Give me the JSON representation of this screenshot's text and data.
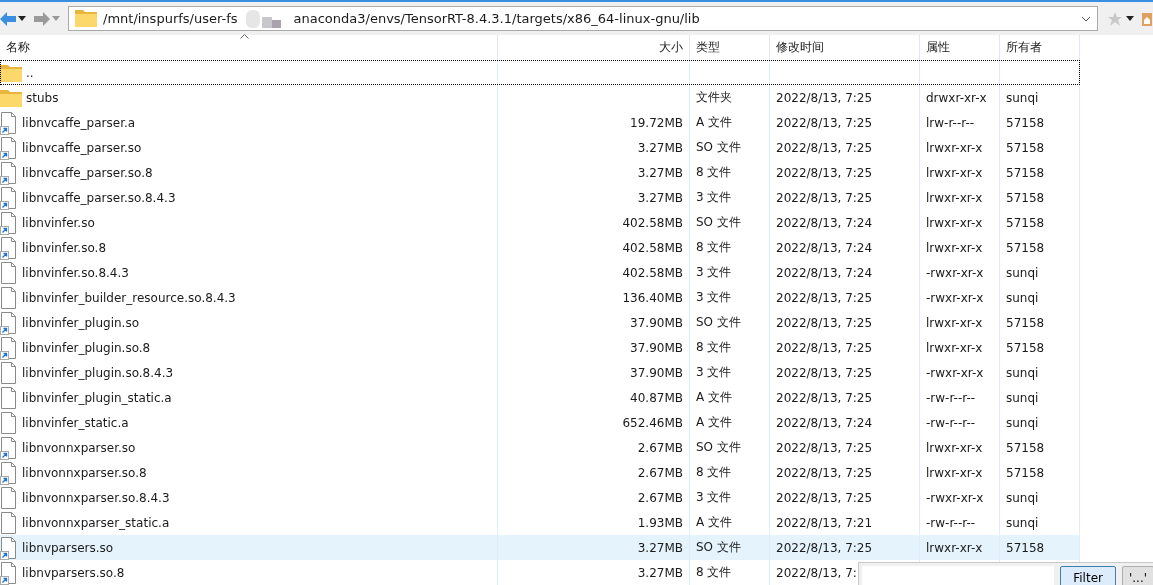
{
  "toolbar": {
    "path_start": "/mnt/inspurfs/user-fs",
    "path_end": "anaconda3/envs/TensorRT-8.4.3.1/targets/x86_64-linux-gnu/lib"
  },
  "columns": [
    "名称",
    "大小",
    "类型",
    "修改时间",
    "属性",
    "所有者"
  ],
  "rows": [
    {
      "kind": "folder",
      "name": "..",
      "selected": false,
      "focused": true
    },
    {
      "kind": "folder",
      "name": "stubs",
      "type": "文件夹",
      "modified": "2022/8/13, 7:25",
      "attributes": "drwxr-xr-x",
      "owner": "sunqi",
      "selected": false,
      "focused": false
    },
    {
      "kind": "link",
      "name": "libnvcaffe_parser.a",
      "size": "19.72MB",
      "type": "A 文件",
      "modified": "2022/8/13, 7:25",
      "attributes": "lrw-r--r--",
      "owner": "57158",
      "selected": false,
      "focused": false
    },
    {
      "kind": "link",
      "name": "libnvcaffe_parser.so",
      "size": "3.27MB",
      "type": "SO 文件",
      "modified": "2022/8/13, 7:25",
      "attributes": "lrwxr-xr-x",
      "owner": "57158",
      "selected": false,
      "focused": false
    },
    {
      "kind": "link",
      "name": "libnvcaffe_parser.so.8",
      "size": "3.27MB",
      "type": "8 文件",
      "modified": "2022/8/13, 7:25",
      "attributes": "lrwxr-xr-x",
      "owner": "57158",
      "selected": false,
      "focused": false
    },
    {
      "kind": "link",
      "name": "libnvcaffe_parser.so.8.4.3",
      "size": "3.27MB",
      "type": "3 文件",
      "modified": "2022/8/13, 7:25",
      "attributes": "lrwxr-xr-x",
      "owner": "57158",
      "selected": false,
      "focused": false
    },
    {
      "kind": "link",
      "name": "libnvinfer.so",
      "size": "402.58MB",
      "type": "SO 文件",
      "modified": "2022/8/13, 7:24",
      "attributes": "lrwxr-xr-x",
      "owner": "57158",
      "selected": false,
      "focused": false
    },
    {
      "kind": "link",
      "name": "libnvinfer.so.8",
      "size": "402.58MB",
      "type": "8 文件",
      "modified": "2022/8/13, 7:24",
      "attributes": "lrwxr-xr-x",
      "owner": "57158",
      "selected": false,
      "focused": false
    },
    {
      "kind": "file",
      "name": "libnvinfer.so.8.4.3",
      "size": "402.58MB",
      "type": "3 文件",
      "modified": "2022/8/13, 7:24",
      "attributes": "-rwxr-xr-x",
      "owner": "sunqi",
      "selected": false,
      "focused": false
    },
    {
      "kind": "file",
      "name": "libnvinfer_builder_resource.so.8.4.3",
      "size": "136.40MB",
      "type": "3 文件",
      "modified": "2022/8/13, 7:25",
      "attributes": "-rwxr-xr-x",
      "owner": "sunqi",
      "selected": false,
      "focused": false
    },
    {
      "kind": "link",
      "name": "libnvinfer_plugin.so",
      "size": "37.90MB",
      "type": "SO 文件",
      "modified": "2022/8/13, 7:25",
      "attributes": "lrwxr-xr-x",
      "owner": "57158",
      "selected": false,
      "focused": false
    },
    {
      "kind": "link",
      "name": "libnvinfer_plugin.so.8",
      "size": "37.90MB",
      "type": "8 文件",
      "modified": "2022/8/13, 7:25",
      "attributes": "lrwxr-xr-x",
      "owner": "57158",
      "selected": false,
      "focused": false
    },
    {
      "kind": "file",
      "name": "libnvinfer_plugin.so.8.4.3",
      "size": "37.90MB",
      "type": "3 文件",
      "modified": "2022/8/13, 7:25",
      "attributes": "-rwxr-xr-x",
      "owner": "sunqi",
      "selected": false,
      "focused": false
    },
    {
      "kind": "file",
      "name": "libnvinfer_plugin_static.a",
      "size": "40.87MB",
      "type": "A 文件",
      "modified": "2022/8/13, 7:25",
      "attributes": "-rw-r--r--",
      "owner": "sunqi",
      "selected": false,
      "focused": false
    },
    {
      "kind": "file",
      "name": "libnvinfer_static.a",
      "size": "652.46MB",
      "type": "A 文件",
      "modified": "2022/8/13, 7:24",
      "attributes": "-rw-r--r--",
      "owner": "sunqi",
      "selected": false,
      "focused": false
    },
    {
      "kind": "link",
      "name": "libnvonnxparser.so",
      "size": "2.67MB",
      "type": "SO 文件",
      "modified": "2022/8/13, 7:25",
      "attributes": "lrwxr-xr-x",
      "owner": "57158",
      "selected": false,
      "focused": false
    },
    {
      "kind": "link",
      "name": "libnvonnxparser.so.8",
      "size": "2.67MB",
      "type": "8 文件",
      "modified": "2022/8/13, 7:25",
      "attributes": "lrwxr-xr-x",
      "owner": "57158",
      "selected": false,
      "focused": false
    },
    {
      "kind": "file",
      "name": "libnvonnxparser.so.8.4.3",
      "size": "2.67MB",
      "type": "3 文件",
      "modified": "2022/8/13, 7:25",
      "attributes": "-rwxr-xr-x",
      "owner": "sunqi",
      "selected": false,
      "focused": false
    },
    {
      "kind": "file",
      "name": "libnvonnxparser_static.a",
      "size": "1.93MB",
      "type": "A 文件",
      "modified": "2022/8/13, 7:21",
      "attributes": "-rw-r--r--",
      "owner": "sunqi",
      "selected": false,
      "focused": false
    },
    {
      "kind": "link",
      "name": "libnvparsers.so",
      "size": "3.27MB",
      "type": "SO 文件",
      "modified": "2022/8/13, 7:25",
      "attributes": "lrwxr-xr-x",
      "owner": "57158",
      "selected": true,
      "focused": false
    },
    {
      "kind": "link",
      "name": "libnvparsers.so.8",
      "size": "3.27MB",
      "type": "8 文件",
      "modified": "2022/8/13, 7:",
      "selected": false,
      "focused": false
    }
  ],
  "filter_popup": {
    "button": "Filter",
    "quote_button": "'...'"
  }
}
